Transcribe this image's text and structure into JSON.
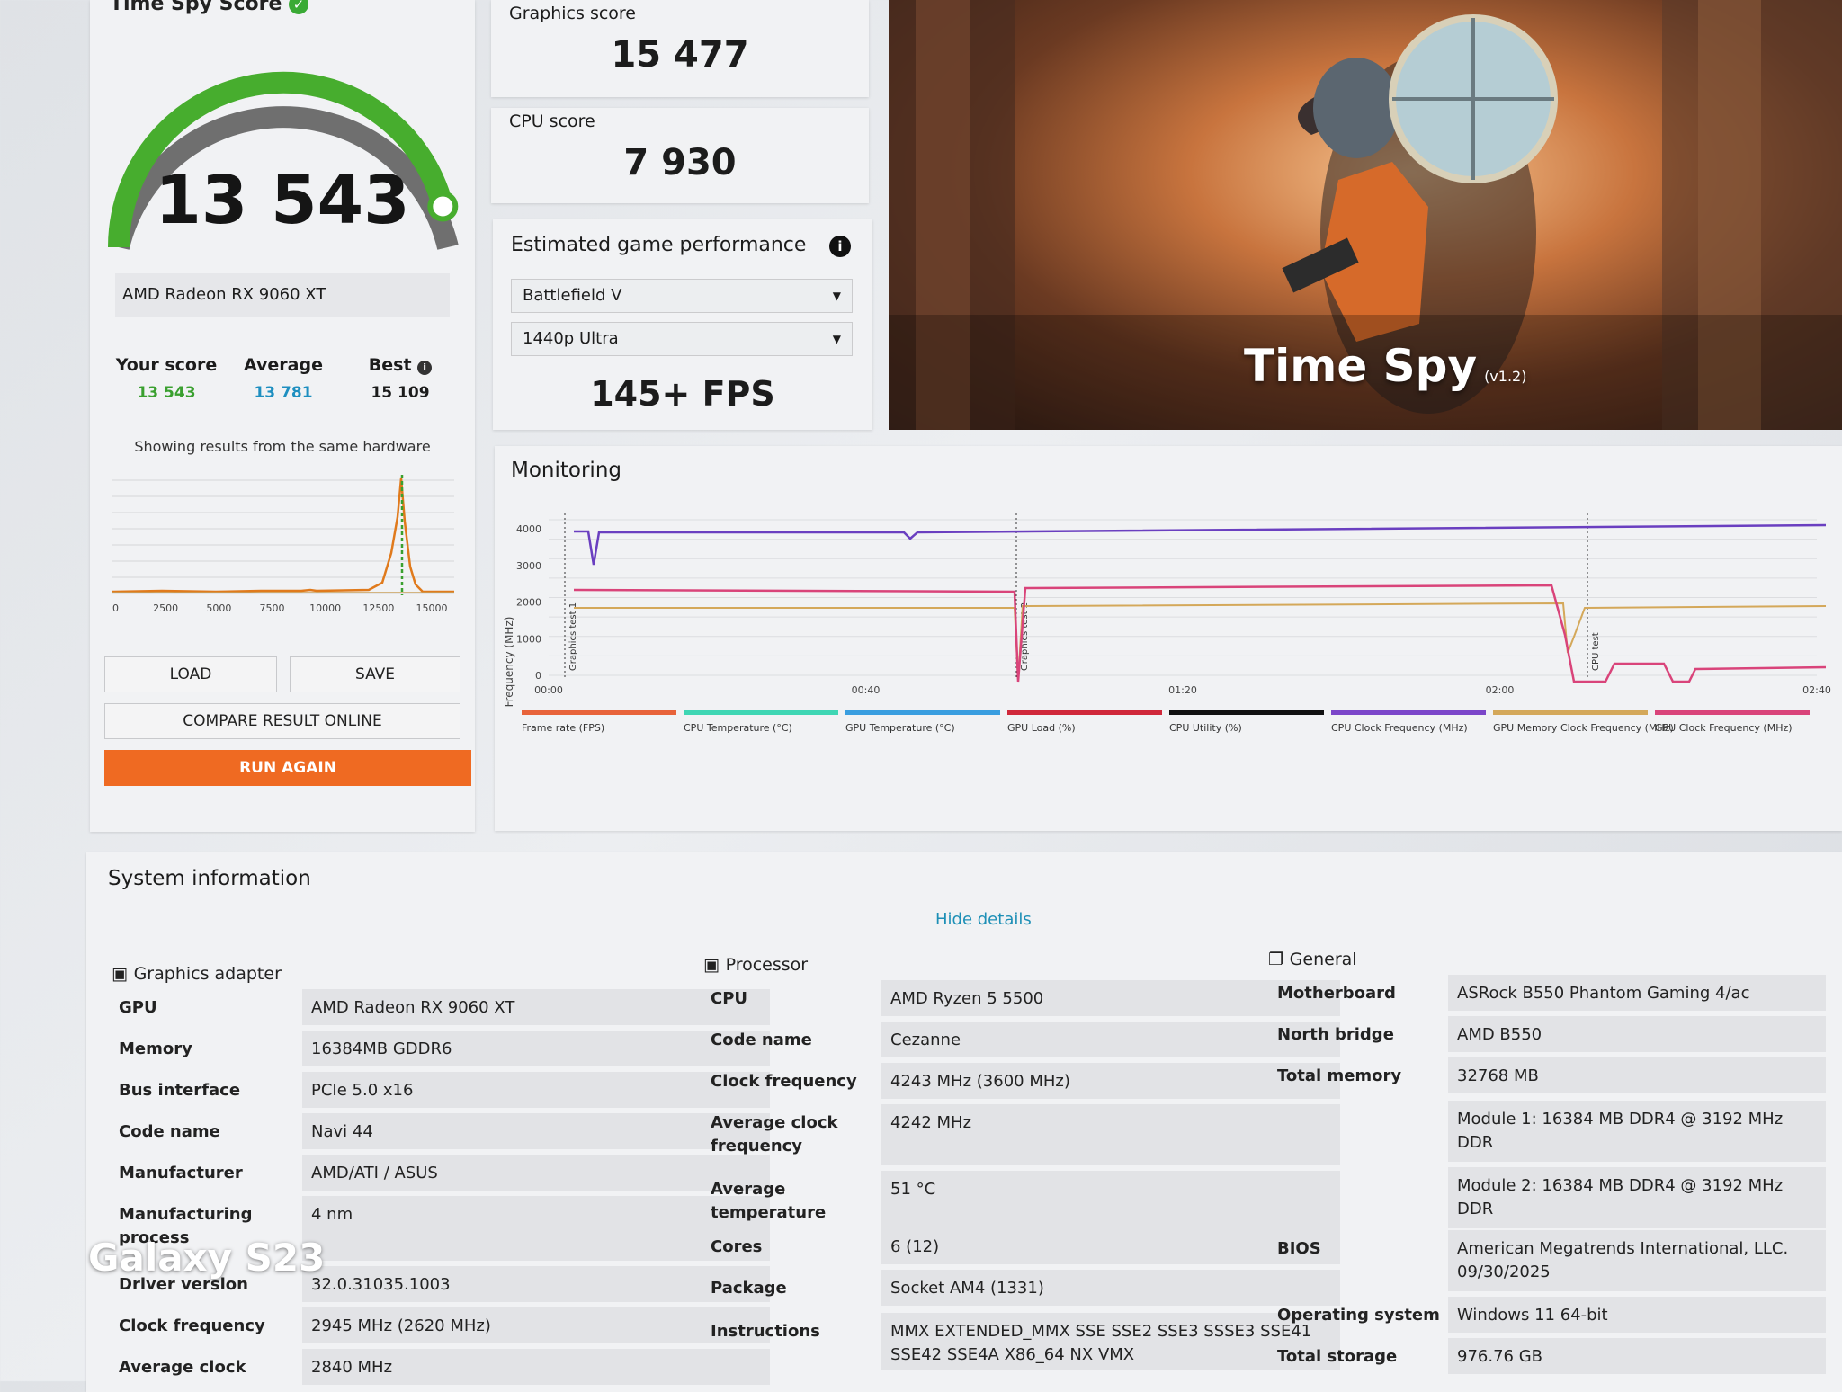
{
  "score_card": {
    "title": "Time Spy Score",
    "score": "13 543",
    "gpu": "AMD Radeon RX 9060 XT",
    "your_score_label": "Your score",
    "your_score": "13 543",
    "average_label": "Average",
    "average": "13 781",
    "best_label": "Best",
    "best": "15 109",
    "showing_text": "Showing results from the same hardware",
    "gauge_fraction": 0.92,
    "dist_ticks": [
      "0",
      "2500",
      "5000",
      "7500",
      "10000",
      "12500",
      "15000"
    ],
    "load_label": "LOAD",
    "save_label": "SAVE",
    "compare_label": "COMPARE RESULT ONLINE",
    "run_label": "RUN AGAIN"
  },
  "graphics": {
    "label": "Graphics score",
    "value": "15 477"
  },
  "cpu": {
    "label": "CPU score",
    "value": "7 930"
  },
  "estimate": {
    "title": "Estimated game performance",
    "game": "Battlefield V",
    "preset": "1440p Ultra",
    "fps": "145+ FPS"
  },
  "hero": {
    "title": "Time Spy",
    "version": "(v1.2)"
  },
  "monitoring": {
    "title": "Monitoring",
    "y_label": "Frequency (MHz)",
    "y_ticks": [
      "0",
      "1000",
      "2000",
      "3000",
      "4000"
    ],
    "x_ticks": [
      "00:00",
      "00:40",
      "01:20",
      "02:00",
      "02:40"
    ],
    "markers": [
      "Graphics test 1",
      "Graphics test 2",
      "CPU test"
    ],
    "legend": [
      {
        "name": "Frame rate (FPS)",
        "color": "#e8633a"
      },
      {
        "name": "CPU Temperature (°C)",
        "color": "#3fd6b4"
      },
      {
        "name": "GPU Temperature (°C)",
        "color": "#3a9ee0"
      },
      {
        "name": "GPU Load (%)",
        "color": "#d0283a"
      },
      {
        "name": "CPU Utility (%)",
        "color": "#111111"
      },
      {
        "name": "CPU Clock Frequency (MHz)",
        "color": "#7b46c9"
      },
      {
        "name": "GPU Memory Clock Frequency (MHz)",
        "color": "#d4a85a"
      },
      {
        "name": "GPU Clock Frequency (MHz)",
        "color": "#d9447a"
      }
    ]
  },
  "system": {
    "title": "System information",
    "hide_details": "Hide details",
    "graphics_title": "Graphics adapter",
    "processor_title": "Processor",
    "general_title": "General",
    "graphics_rows": [
      {
        "label": "GPU",
        "value": "AMD Radeon RX 9060 XT"
      },
      {
        "label": "Memory",
        "value": "16384MB GDDR6"
      },
      {
        "label": "Bus interface",
        "value": "PCIe 5.0 x16"
      },
      {
        "label": "Code name",
        "value": "Navi 44"
      },
      {
        "label": "Manufacturer",
        "value": "AMD/ATI / ASUS"
      },
      {
        "label": "Manufacturing process",
        "value": "4 nm"
      },
      {
        "label": "Driver version",
        "value": "32.0.31035.1003"
      },
      {
        "label": "Clock frequency",
        "value": "2945 MHz (2620 MHz)"
      },
      {
        "label": "Average clock",
        "value": "2840 MHz"
      }
    ],
    "processor_rows": [
      {
        "label": "CPU",
        "value": "AMD Ryzen 5 5500"
      },
      {
        "label": "Code name",
        "value": "Cezanne"
      },
      {
        "label": "Clock frequency",
        "value": "4243 MHz (3600 MHz)"
      },
      {
        "label": "Average clock frequency",
        "value": "4242 MHz"
      },
      {
        "label": "Average temperature",
        "value": "51 °C"
      },
      {
        "label": "Cores",
        "value": "6 (12)"
      },
      {
        "label": "Package",
        "value": "Socket AM4 (1331)"
      },
      {
        "label": "Instructions",
        "value": "MMX EXTENDED_MMX SSE SSE2 SSE3 SSSE3 SSE41 SSE42 SSE4A X86_64 NX VMX"
      }
    ],
    "general_rows": [
      {
        "label": "Motherboard",
        "value": "ASRock B550 Phantom Gaming 4/ac"
      },
      {
        "label": "North bridge",
        "value": "AMD B550"
      },
      {
        "label": "Total memory",
        "value": "32768 MB"
      },
      {
        "label": "",
        "value": "Module 1: 16384 MB DDR4 @ 3192 MHz DDR"
      },
      {
        "label": "",
        "value": "Module 2: 16384 MB DDR4 @ 3192 MHz DDR"
      },
      {
        "label": "BIOS",
        "value": "American Megatrends International, LLC. 09/30/2025"
      },
      {
        "label": "Operating system",
        "value": "Windows 11 64-bit"
      },
      {
        "label": "Total storage",
        "value": "976.76 GB"
      }
    ]
  },
  "watermark": "Galaxy S23"
}
